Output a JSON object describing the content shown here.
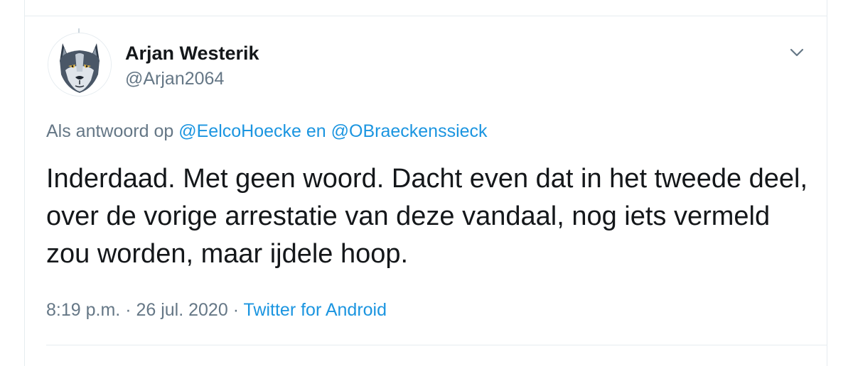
{
  "tweet": {
    "author_name": "Arjan Westerik",
    "author_handle": "@Arjan2064",
    "reply_prefix": "Als antwoord op",
    "reply_to_1": "@EelcoHoecke",
    "reply_joiner": "en",
    "reply_to_2": "@OBraeckenssieck",
    "text": "Inderdaad. Met geen woord. Dacht even dat in het tweede deel, over de vorige arrestatie van deze vandaal, nog iets vermeld zou worden, maar ijdele hoop.",
    "time": "8:19 p.m.",
    "separator": "·",
    "date": "26 jul. 2020",
    "source": "Twitter for Android"
  },
  "icons": {
    "avatar": "wolf-avatar-icon",
    "menu": "chevron-down-icon"
  },
  "colors": {
    "link": "#1b95e0",
    "secondary_text": "#657786",
    "primary_text": "#14171a",
    "border": "#e6ecf0"
  }
}
